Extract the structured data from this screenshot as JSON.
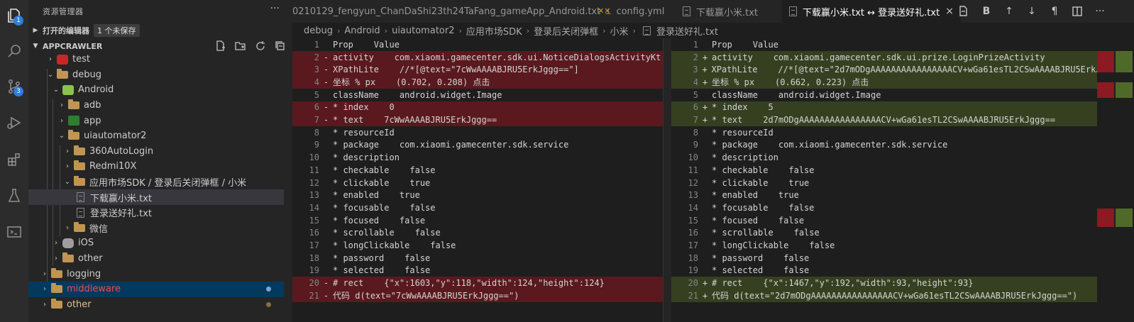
{
  "activity_bar": {
    "items": [
      {
        "icon": "explorer-icon",
        "badge": "1"
      },
      {
        "icon": "search-icon",
        "badge": ""
      },
      {
        "icon": "source-control-icon",
        "badge": "3"
      },
      {
        "icon": "run-debug-icon",
        "badge": ""
      },
      {
        "icon": "extensions-icon",
        "badge": ""
      },
      {
        "icon": "testing-icon",
        "badge": ""
      },
      {
        "icon": "terminal-icon",
        "badge": ""
      }
    ]
  },
  "sidebar": {
    "title": "资源管理器",
    "more": "···",
    "open_editors": {
      "label": "打开的编辑器",
      "badge": "1 个未保存"
    },
    "workspace": {
      "label": "APPCRAWLER"
    },
    "tree": [
      {
        "label": "test",
        "icon": "test-folder-icon",
        "expanded": false
      },
      {
        "label": "debug",
        "icon": "folder-icon",
        "expanded": true
      },
      {
        "label": "Android",
        "icon": "android-folder-icon",
        "expanded": true
      },
      {
        "label": "adb",
        "icon": "folder-icon",
        "expanded": false
      },
      {
        "label": "app",
        "icon": "app-folder-icon",
        "expanded": false
      },
      {
        "label": "uiautomator2",
        "icon": "folder-icon",
        "expanded": true
      },
      {
        "label": "360AutoLogin",
        "icon": "folder-icon",
        "expanded": false
      },
      {
        "label": "Redmi10X",
        "icon": "folder-icon",
        "expanded": false
      },
      {
        "label": "应用市场SDK / 登录后关闭弹框 / 小米",
        "icon": "folder-icon",
        "expanded": true
      },
      {
        "label": "下载赢小米.txt",
        "icon": "file-icon"
      },
      {
        "label": "登录送好礼.txt",
        "icon": "file-icon"
      },
      {
        "label": "微信",
        "icon": "folder-icon",
        "expanded": false
      },
      {
        "label": "iOS",
        "icon": "ios-folder-icon",
        "expanded": false
      },
      {
        "label": "other",
        "icon": "folder-icon",
        "expanded": false
      },
      {
        "label": "logging",
        "icon": "folder-icon",
        "expanded": false
      },
      {
        "label": "middleware",
        "icon": "folder-icon",
        "expanded": false
      },
      {
        "label": "other",
        "icon": "folder-icon",
        "expanded": false
      }
    ]
  },
  "tabs": [
    {
      "label": "0210129_fengyun_ChanDaShi23th24TaFang_gameApp_Android.txt",
      "icon": "",
      "suffix": "pin"
    },
    {
      "label": "config.yml",
      "icon": "yaml-icon"
    },
    {
      "label": "下载赢小米.txt",
      "icon": "file-icon"
    },
    {
      "label": "下载赢小米.txt ↔ 登录送好礼.txt",
      "icon": "diff-file-icon",
      "close": "×"
    }
  ],
  "tab_actions": [
    "open-file-icon",
    "B",
    "↑",
    "↓",
    "¶",
    "split-editor-icon",
    "···"
  ],
  "breadcrumb": [
    "debug",
    "Android",
    "uiautomator2",
    "应用市场SDK",
    "登录后关闭弹框",
    "小米",
    "登录送好礼.txt"
  ],
  "diff": {
    "left": [
      {
        "n": "1",
        "m": "",
        "k": "",
        "t": "Prop    Value"
      },
      {
        "n": "2",
        "m": "-",
        "k": "del",
        "t": "activity    com.xiaomi.gamecenter.sdk.ui.NoticeDialogsActivityKt"
      },
      {
        "n": "3",
        "m": "-",
        "k": "del",
        "t": "XPathLite    //*[@text=\"7cWwAAAABJRU5ErkJggg==\"]"
      },
      {
        "n": "4",
        "m": "-",
        "k": "del",
        "t": "坐标 % px    (0.702, 0.208) 点击"
      },
      {
        "n": "5",
        "m": "",
        "k": "",
        "t": "className    android.widget.Image"
      },
      {
        "n": "6",
        "m": "-",
        "k": "del",
        "t": "* index    0"
      },
      {
        "n": "7",
        "m": "-",
        "k": "del",
        "t": "* text    7cWwAAAABJRU5ErkJggg=="
      },
      {
        "n": "8",
        "m": "",
        "k": "",
        "t": "* resourceId"
      },
      {
        "n": "9",
        "m": "",
        "k": "",
        "t": "* package    com.xiaomi.gamecenter.sdk.service"
      },
      {
        "n": "10",
        "m": "",
        "k": "",
        "t": "* description"
      },
      {
        "n": "11",
        "m": "",
        "k": "",
        "t": "* checkable    false"
      },
      {
        "n": "12",
        "m": "",
        "k": "",
        "t": "* clickable    true"
      },
      {
        "n": "13",
        "m": "",
        "k": "",
        "t": "* enabled    true"
      },
      {
        "n": "14",
        "m": "",
        "k": "",
        "t": "* focusable    false"
      },
      {
        "n": "15",
        "m": "",
        "k": "",
        "t": "* focused    false"
      },
      {
        "n": "16",
        "m": "",
        "k": "",
        "t": "* scrollable    false"
      },
      {
        "n": "17",
        "m": "",
        "k": "",
        "t": "* longClickable    false"
      },
      {
        "n": "18",
        "m": "",
        "k": "",
        "t": "* password    false"
      },
      {
        "n": "19",
        "m": "",
        "k": "",
        "t": "* selected    false"
      },
      {
        "n": "20",
        "m": "-",
        "k": "del",
        "t": "# rect    {\"x\":1603,\"y\":118,\"width\":124,\"height\":124}"
      },
      {
        "n": "21",
        "m": "-",
        "k": "del",
        "t": "代码 d(text=\"7cWwAAAABJRU5ErkJggg==\")"
      }
    ],
    "right": [
      {
        "n": "1",
        "m": "",
        "k": "",
        "t": "Prop    Value"
      },
      {
        "n": "2",
        "m": "+",
        "k": "ins",
        "t": "activity    com.xiaomi.gamecenter.sdk.ui.prize.LoginPrizeActivity"
      },
      {
        "n": "3",
        "m": "+",
        "k": "ins",
        "t": "XPathLite    //*[@text=\"2d7mODgAAAAAAAAAAAAAAAACV+wGa61esTL2CSwAAAABJRU5ErkJ"
      },
      {
        "n": "4",
        "m": "+",
        "k": "ins",
        "t": "坐标 % px    (0.662, 0.223) 点击"
      },
      {
        "n": "5",
        "m": "",
        "k": "",
        "t": "className    android.widget.Image"
      },
      {
        "n": "6",
        "m": "+",
        "k": "ins",
        "t": "* index    5"
      },
      {
        "n": "7",
        "m": "+",
        "k": "ins",
        "t": "* text    2d7mODgAAAAAAAAAAAAAAAACV+wGa61esTL2CSwAAAABJRU5ErkJggg=="
      },
      {
        "n": "8",
        "m": "",
        "k": "",
        "t": "* resourceId"
      },
      {
        "n": "9",
        "m": "",
        "k": "",
        "t": "* package    com.xiaomi.gamecenter.sdk.service"
      },
      {
        "n": "10",
        "m": "",
        "k": "",
        "t": "* description"
      },
      {
        "n": "11",
        "m": "",
        "k": "",
        "t": "* checkable    false"
      },
      {
        "n": "12",
        "m": "",
        "k": "",
        "t": "* clickable    true"
      },
      {
        "n": "13",
        "m": "",
        "k": "",
        "t": "* enabled    true"
      },
      {
        "n": "14",
        "m": "",
        "k": "",
        "t": "* focusable    false"
      },
      {
        "n": "15",
        "m": "",
        "k": "",
        "t": "* focused    false"
      },
      {
        "n": "16",
        "m": "",
        "k": "",
        "t": "* scrollable    false"
      },
      {
        "n": "17",
        "m": "",
        "k": "",
        "t": "* longClickable    false"
      },
      {
        "n": "18",
        "m": "",
        "k": "",
        "t": "* password    false"
      },
      {
        "n": "19",
        "m": "",
        "k": "",
        "t": "* selected    false"
      },
      {
        "n": "20",
        "m": "+",
        "k": "ins",
        "t": "# rect    {\"x\":1467,\"y\":192,\"width\":93,\"height\":93}"
      },
      {
        "n": "21",
        "m": "+",
        "k": "ins",
        "t": "代码 d(text=\"2d7mODgAAAAAAAAAAAAAAAACV+wGa61esTL2CSwAAAABJRU5ErkJggg==\")"
      }
    ]
  },
  "colors": {
    "deleted": "#8b1a22",
    "inserted": "#4f6a28",
    "folder": "#c09553",
    "accent": "#2f7fd8"
  }
}
